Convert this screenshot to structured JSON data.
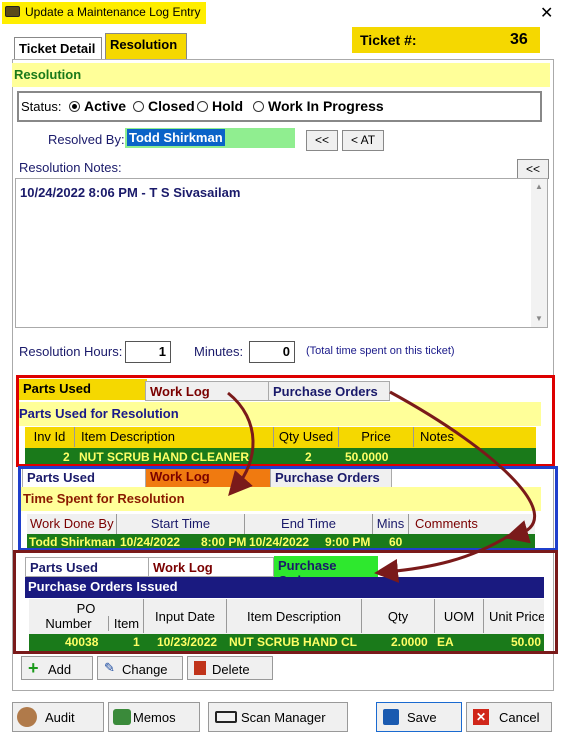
{
  "window": {
    "title": "Update a Maintenance Log Entry",
    "close": "✕"
  },
  "tabs": {
    "ticket_detail": "Ticket Detail",
    "resolution": "Resolution"
  },
  "ticket": {
    "label": "Ticket #:",
    "number": "36"
  },
  "resolution": {
    "header": "Resolution",
    "status_label": "Status:",
    "status_options": [
      "Active",
      "Closed",
      "Hold",
      "Work In Progress"
    ],
    "status_selected": "Active",
    "resolved_by_label": "Resolved By:",
    "resolved_by": "Todd Shirkman",
    "btn_back": "<<",
    "btn_at": "< AT",
    "notes_label": "Resolution Notes:",
    "notes_btn": "<<",
    "notes_text": "10/24/2022  8:06 PM - T S Sivasailam",
    "hours_label": "Resolution Hours:",
    "hours": "1",
    "minutes_label": "Minutes:",
    "minutes": "0",
    "time_note": "(Total time spent on this ticket)"
  },
  "subtabs": {
    "parts": "Parts Used",
    "worklog": "Work Log",
    "po": "Purchase Orders"
  },
  "parts": {
    "title": "Parts Used for Resolution",
    "headers": [
      "Inv Id",
      "Item Description",
      "Qty Used",
      "Price",
      "Notes"
    ],
    "row": [
      "2",
      "NUT SCRUB HAND CLEANER",
      "2",
      "50.0000",
      ""
    ]
  },
  "worklog": {
    "title": "Time Spent for Resolution",
    "headers": [
      "Work Done By",
      "Start Time",
      "End Time",
      "Mins",
      "Comments"
    ],
    "row": [
      "Todd Shirkman",
      "10/24/2022",
      "8:00 PM",
      "10/24/2022",
      "9:00 PM",
      "60",
      ""
    ]
  },
  "po": {
    "title": "Purchase Orders Issued",
    "headers": [
      "PO",
      "Number",
      "Item",
      "Input Date",
      "Item Description",
      "Qty",
      "UOM",
      "Unit Price"
    ],
    "row": [
      "40038",
      "1",
      "10/23/2022",
      "NUT SCRUB HAND CL",
      "2.0000",
      "EA",
      "50.00"
    ]
  },
  "grid_buttons": {
    "add": "Add",
    "change": "Change",
    "delete": "Delete"
  },
  "bottom": {
    "audit": "Audit",
    "memos": "Memos",
    "scan": "Scan Manager",
    "save": "Save",
    "cancel": "Cancel"
  },
  "colors": {
    "yellow": "#f5d800",
    "green_row": "#1a7a1a",
    "red_frame": "#dd0000",
    "blue_frame": "#1f3fcc"
  }
}
